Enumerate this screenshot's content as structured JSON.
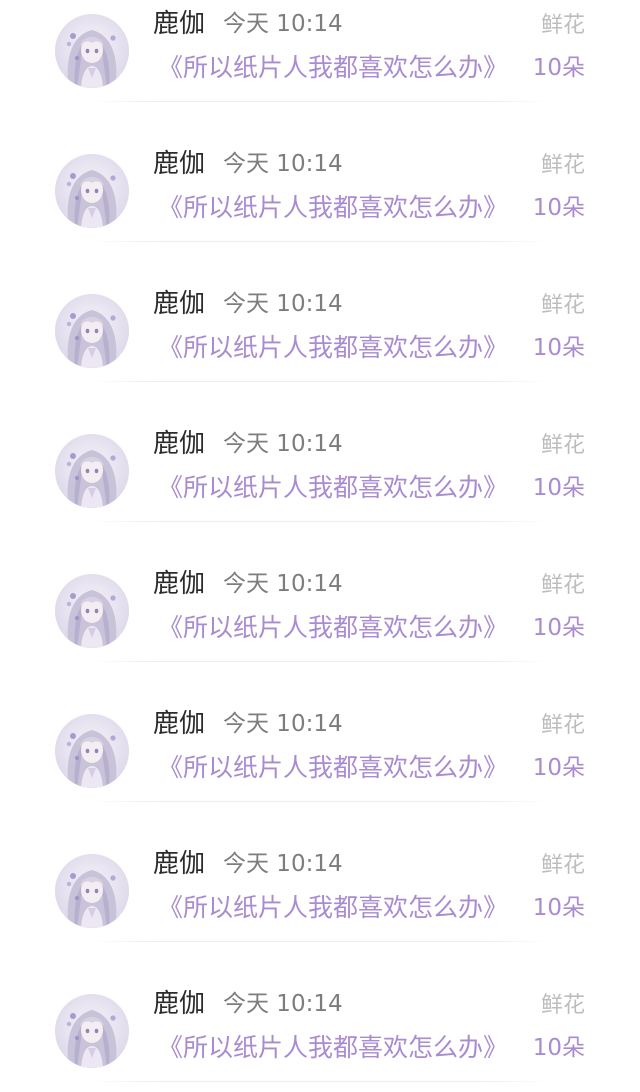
{
  "records": [
    {
      "name": "鹿伽",
      "time": "今天 10:14",
      "title": "《所以纸片人我都喜欢怎么办》",
      "gift_label": "鲜花",
      "gift_count": "10朵",
      "avatar_icon": "avatar-anime-girl-icon"
    },
    {
      "name": "鹿伽",
      "time": "今天 10:14",
      "title": "《所以纸片人我都喜欢怎么办》",
      "gift_label": "鲜花",
      "gift_count": "10朵",
      "avatar_icon": "avatar-anime-girl-icon"
    },
    {
      "name": "鹿伽",
      "time": "今天 10:14",
      "title": "《所以纸片人我都喜欢怎么办》",
      "gift_label": "鲜花",
      "gift_count": "10朵",
      "avatar_icon": "avatar-anime-girl-icon"
    },
    {
      "name": "鹿伽",
      "time": "今天 10:14",
      "title": "《所以纸片人我都喜欢怎么办》",
      "gift_label": "鲜花",
      "gift_count": "10朵",
      "avatar_icon": "avatar-anime-girl-icon"
    },
    {
      "name": "鹿伽",
      "time": "今天 10:14",
      "title": "《所以纸片人我都喜欢怎么办》",
      "gift_label": "鲜花",
      "gift_count": "10朵",
      "avatar_icon": "avatar-anime-girl-icon"
    },
    {
      "name": "鹿伽",
      "time": "今天 10:14",
      "title": "《所以纸片人我都喜欢怎么办》",
      "gift_label": "鲜花",
      "gift_count": "10朵",
      "avatar_icon": "avatar-anime-girl-icon"
    },
    {
      "name": "鹿伽",
      "time": "今天 10:14",
      "title": "《所以纸片人我都喜欢怎么办》",
      "gift_label": "鲜花",
      "gift_count": "10朵",
      "avatar_icon": "avatar-anime-girl-icon"
    },
    {
      "name": "鹿伽",
      "time": "今天 10:14",
      "title": "《所以纸片人我都喜欢怎么办》",
      "gift_label": "鲜花",
      "gift_count": "10朵",
      "avatar_icon": "avatar-anime-girl-icon"
    }
  ],
  "colors": {
    "accent_purple": "#a98bd2",
    "name_text": "#2b2b2b",
    "time_text": "#7d7d7d",
    "gift_label_text": "#bdbdbd",
    "divider": "#ececf0",
    "background": "#ffffff"
  }
}
